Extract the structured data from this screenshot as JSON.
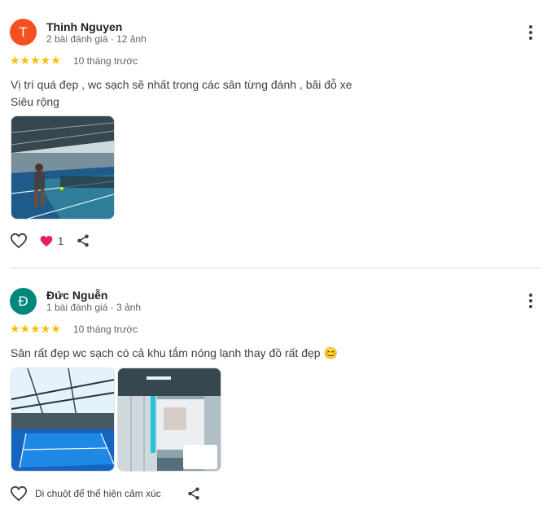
{
  "reviews": [
    {
      "author": "Thinh Nguyen",
      "initial": "T",
      "avatar_color": "#f4511e",
      "meta": "2 bài đánh giá · 12 ảnh",
      "rating": 5,
      "stars_text": "★★★★★",
      "time": "10 tháng trước",
      "text_line1": "Vị trí quá đẹp , wc sạch sẽ nhất trong các sân từng đánh , bãi đỗ xe",
      "text_line2": "Siêu rộng",
      "photos": [
        "pickleball-court-player"
      ],
      "reactions": {
        "emoji": "heart",
        "count": "1"
      },
      "icons": [
        "heart-outline-icon",
        "share-icon",
        "more-vert-icon"
      ]
    },
    {
      "author": "Đức Nguễn",
      "initial": "Đ",
      "avatar_color": "#00897b",
      "meta": "1 bài đánh giá · 3 ảnh",
      "rating": 5,
      "stars_text": "★★★★★",
      "time": "10 tháng trước",
      "text": "Sân rất đẹp wc sạch có cả khu tắm nóng lạnh thay đồ rất đẹp",
      "emoji": "😊",
      "photos": [
        "covered-court",
        "restroom"
      ],
      "react_hint": "Di chuột để thể hiện cảm xúc",
      "icons": [
        "heart-outline-icon",
        "share-icon",
        "more-vert-icon"
      ]
    }
  ]
}
